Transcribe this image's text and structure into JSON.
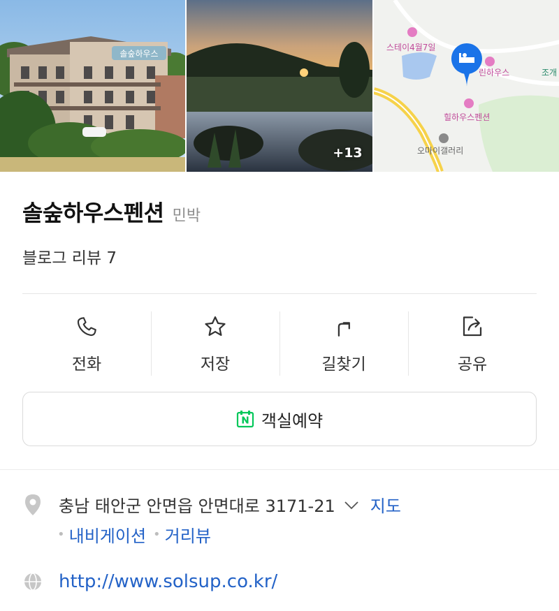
{
  "photos": {
    "more_count": "+13",
    "map_labels": {
      "stay": "스테이4월7일",
      "pin_place": "린하우스",
      "right_edge": "조개",
      "hill_house": "힐하우스펜션",
      "gallery": "오마이갤러리"
    },
    "sign_text": "솔숲하우스"
  },
  "place": {
    "name": "솔숲하우스펜션",
    "category": "민박",
    "review": "블로그 리뷰 7"
  },
  "actions": [
    {
      "label": "전화",
      "icon": "phone-icon"
    },
    {
      "label": "저장",
      "icon": "star-icon"
    },
    {
      "label": "길찾기",
      "icon": "directions-icon"
    },
    {
      "label": "공유",
      "icon": "share-icon"
    }
  ],
  "reserve": {
    "label": "객실예약",
    "icon": "naver-calendar-icon",
    "color": "#03c75a"
  },
  "address": {
    "text": "충남 태안군 안면읍 안면대로 3171-21",
    "map_link": "지도",
    "sub_links": [
      "내비게이션",
      "거리뷰"
    ]
  },
  "website": {
    "url": "http://www.solsup.co.kr/"
  },
  "colors": {
    "link": "#2362c7",
    "map_pin": "#1a73e8"
  }
}
